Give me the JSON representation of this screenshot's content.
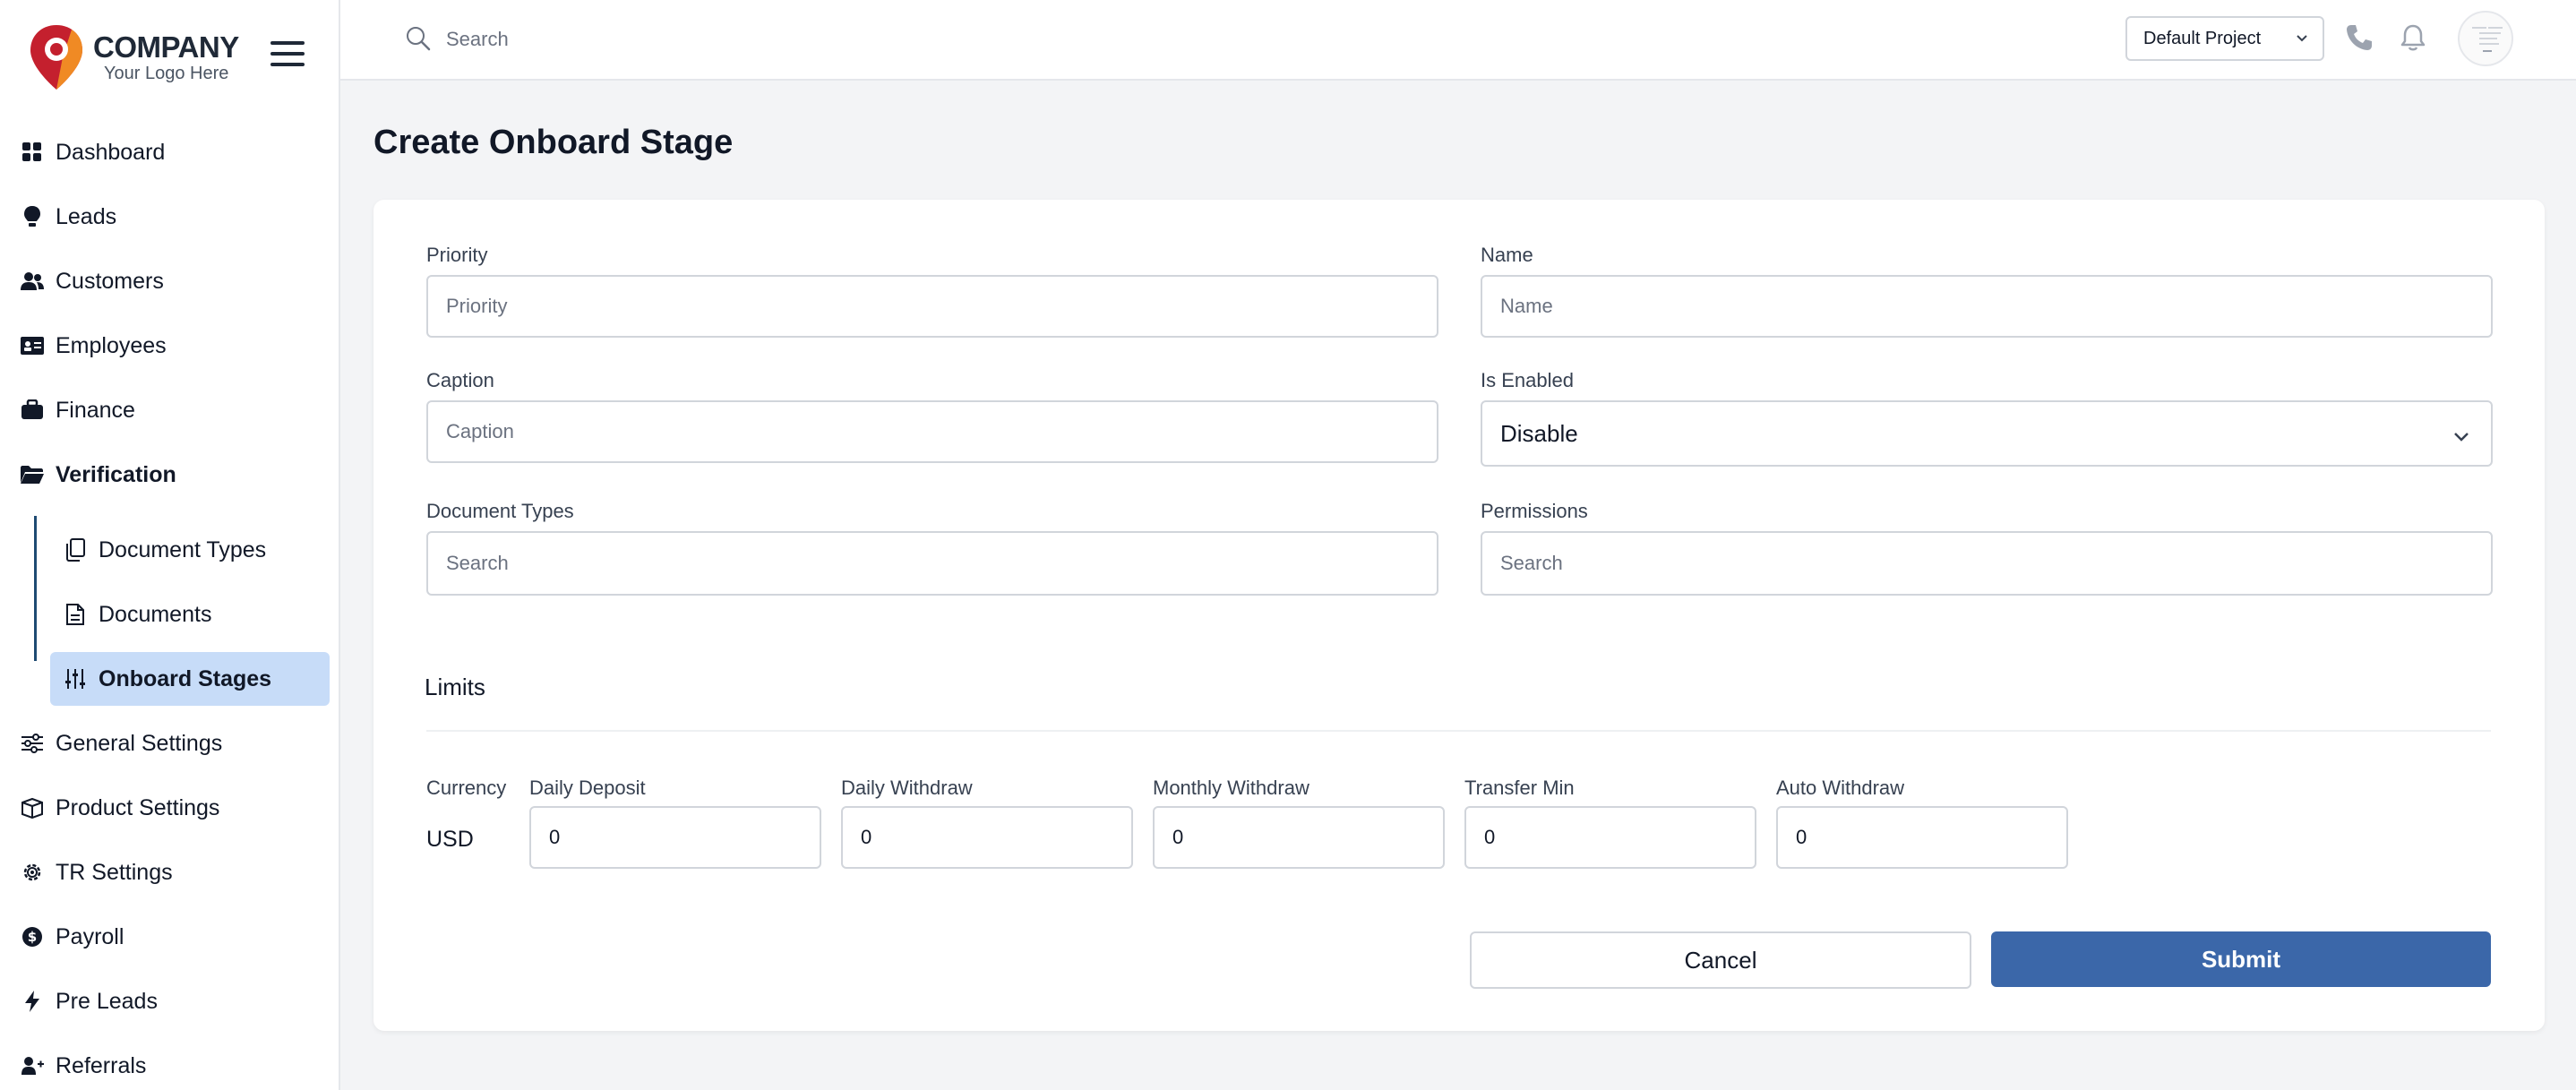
{
  "brand": {
    "title": "COMPANY",
    "subtitle": "Your Logo Here",
    "colors": {
      "primary": "#c4202e",
      "secondary": "#f08a24"
    }
  },
  "topbar": {
    "search_placeholder": "Search",
    "project": "Default Project"
  },
  "sidebar": {
    "items": [
      {
        "label": "Dashboard",
        "icon": "grid-icon"
      },
      {
        "label": "Leads",
        "icon": "lightbulb-icon"
      },
      {
        "label": "Customers",
        "icon": "users-icon"
      },
      {
        "label": "Employees",
        "icon": "id-card-icon"
      },
      {
        "label": "Finance",
        "icon": "briefcase-icon"
      },
      {
        "label": "Verification",
        "icon": "folder-open-icon"
      },
      {
        "label": "General Settings",
        "icon": "sliders-icon"
      },
      {
        "label": "Product Settings",
        "icon": "box-icon"
      },
      {
        "label": "TR Settings",
        "icon": "gear-icon"
      },
      {
        "label": "Payroll",
        "icon": "dollar-circle-icon"
      },
      {
        "label": "Pre Leads",
        "icon": "bolt-icon"
      },
      {
        "label": "Referrals",
        "icon": "user-plus-icon"
      }
    ],
    "sub_items": [
      {
        "label": "Document Types",
        "icon": "documents-icon"
      },
      {
        "label": "Documents",
        "icon": "document-icon"
      },
      {
        "label": "Onboard Stages",
        "icon": "sliders-vertical-icon"
      }
    ],
    "accent": "#c7dcf8"
  },
  "page": {
    "title": "Create Onboard Stage"
  },
  "form": {
    "priority": {
      "label": "Priority",
      "placeholder": "Priority"
    },
    "name": {
      "label": "Name",
      "placeholder": "Name"
    },
    "caption": {
      "label": "Caption",
      "placeholder": "Caption"
    },
    "is_enabled": {
      "label": "Is Enabled",
      "value": "Disable"
    },
    "document_types": {
      "label": "Document Types",
      "placeholder": "Search"
    },
    "permissions": {
      "label": "Permissions",
      "placeholder": "Search"
    }
  },
  "limits": {
    "title": "Limits",
    "currency_label": "Currency",
    "currency": "USD",
    "columns": [
      {
        "label": "Daily Deposit",
        "value": "0"
      },
      {
        "label": "Daily Withdraw",
        "value": "0"
      },
      {
        "label": "Monthly Withdraw",
        "value": "0"
      },
      {
        "label": "Transfer Min",
        "value": "0"
      },
      {
        "label": "Auto Withdraw",
        "value": "0"
      }
    ]
  },
  "actions": {
    "cancel": "Cancel",
    "submit": "Submit",
    "submit_color": "#3b67a9"
  }
}
